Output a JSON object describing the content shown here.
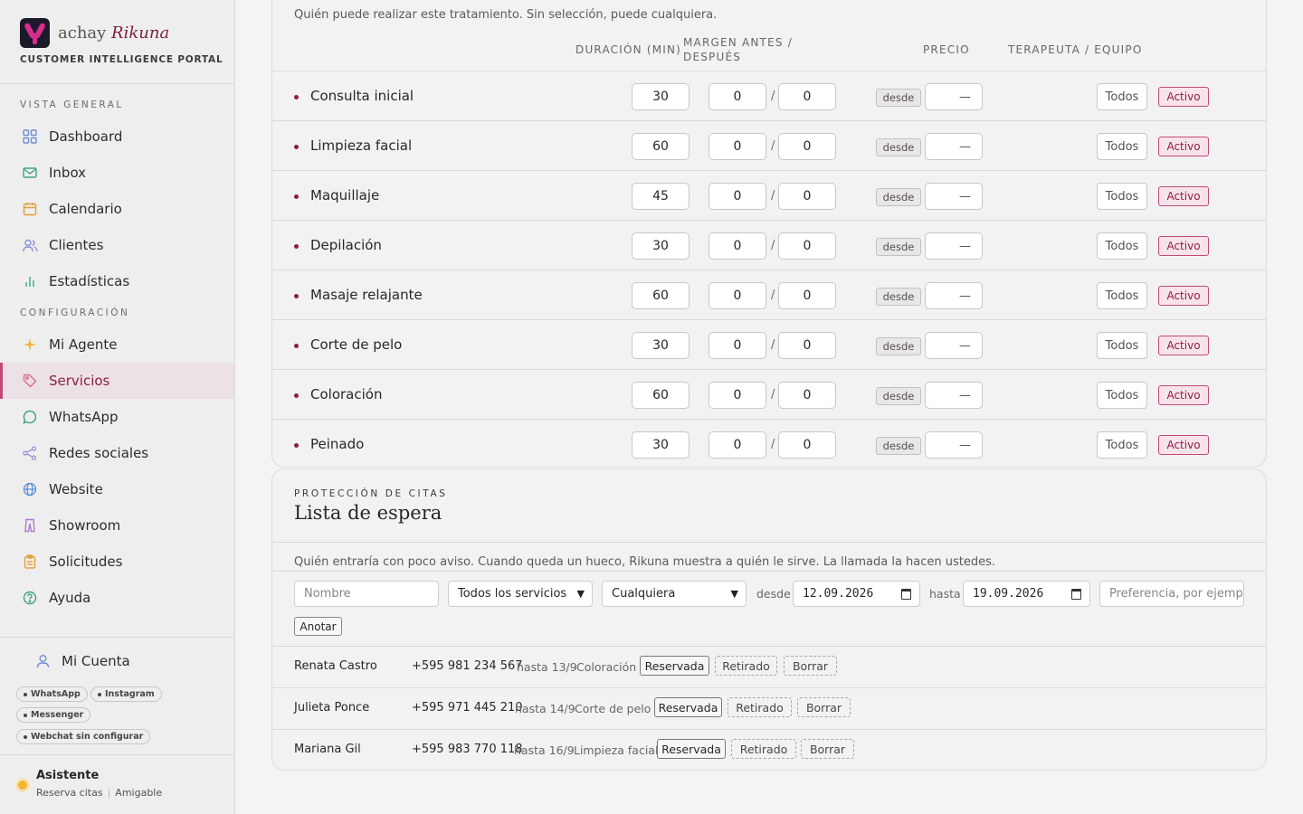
{
  "sidebar": {
    "brand_prefix": "achay",
    "brand_name": "Rikuna",
    "portal": "CUSTOMER INTELLIGENCE PORTAL",
    "section_overview": "VISTA GENERAL",
    "section_config": "CONFIGURACIÓN",
    "items": [
      {
        "label": "Dashboard",
        "icon": "grid-icon"
      },
      {
        "label": "Inbox",
        "icon": "mail-icon"
      },
      {
        "label": "Calendario",
        "icon": "calendar-icon"
      },
      {
        "label": "Clientes",
        "icon": "users-icon"
      },
      {
        "label": "Estadísticas",
        "icon": "bar-chart-icon"
      },
      {
        "label": "Mi Agente",
        "icon": "sparkle-icon"
      },
      {
        "label": "Servicios",
        "icon": "tag-icon"
      },
      {
        "label": "WhatsApp",
        "icon": "chat-bubble-icon"
      },
      {
        "label": "Redes sociales",
        "icon": "share-icon"
      },
      {
        "label": "Website",
        "icon": "globe-icon"
      },
      {
        "label": "Showroom",
        "icon": "hanger-icon"
      },
      {
        "label": "Solicitudes",
        "icon": "clipboard-icon"
      },
      {
        "label": "Ayuda",
        "icon": "help-circle-icon"
      }
    ],
    "account_label": "Mi Cuenta",
    "chips": [
      "WhatsApp",
      "Instagram",
      "Messenger",
      "Webchat sin configurar"
    ],
    "assistant_title": "Asistente",
    "assistant_mode": "Reserva citas",
    "assistant_tone": "Amigable",
    "colors": {
      "accent": "#8c1d45",
      "active_bg": "#ece1e4",
      "status_dot": "#f2b431"
    }
  },
  "services": {
    "intro": "Quién puede realizar este tratamiento. Sin selección, puede cualquiera.",
    "headers": {
      "duration": "DURACIÓN (MIN)",
      "margin": "MARGEN ANTES / DESPUÉS",
      "price": "PRECIO",
      "therapist": "TERAPEUTA / EQUIPO"
    },
    "desde_label": "desde",
    "price_placeholder": "—",
    "todos_label": "Todos",
    "activo_label": "Activo",
    "rows": [
      {
        "name": "Consulta inicial",
        "duration": "30",
        "before": "0",
        "after": "0"
      },
      {
        "name": "Limpieza facial",
        "duration": "60",
        "before": "0",
        "after": "0"
      },
      {
        "name": "Maquillaje",
        "duration": "45",
        "before": "0",
        "after": "0"
      },
      {
        "name": "Depilación",
        "duration": "30",
        "before": "0",
        "after": "0"
      },
      {
        "name": "Masaje relajante",
        "duration": "60",
        "before": "0",
        "after": "0"
      },
      {
        "name": "Corte de pelo",
        "duration": "30",
        "before": "0",
        "after": "0"
      },
      {
        "name": "Coloración",
        "duration": "60",
        "before": "0",
        "after": "0"
      },
      {
        "name": "Peinado",
        "duration": "30",
        "before": "0",
        "after": "0"
      }
    ]
  },
  "waitlist": {
    "eyebrow": "PROTECCIÓN DE CITAS",
    "title": "Lista de espera",
    "description": "Quién entraría con poco aviso. Cuando queda un hueco, Rikuna muestra a quién le sirve. La llamada la hacen ustedes.",
    "name_placeholder": "Nombre",
    "service_select": "Todos los servicios",
    "therapist_select": "Cualquiera",
    "from_label": "desde",
    "from_date": "12.09.2026",
    "to_label": "hasta",
    "to_date": "19.09.2026",
    "preference_placeholder": "Preferencia, por ejemplo",
    "add_button": "Anotar",
    "reserved_label": "Reservada",
    "withdrawn_label": "Retirado",
    "delete_label": "Borrar",
    "entries": [
      {
        "name": "Renata Castro",
        "phone": "+595 981 234 567",
        "until": "hasta 13/9",
        "service": "Coloración"
      },
      {
        "name": "Julieta Ponce",
        "phone": "+595 971 445 210",
        "until": "hasta 14/9",
        "service": "Corte de pelo"
      },
      {
        "name": "Mariana Gil",
        "phone": "+595 983 770 118",
        "until": "hasta 16/9",
        "service": "Limpieza facial"
      }
    ]
  }
}
